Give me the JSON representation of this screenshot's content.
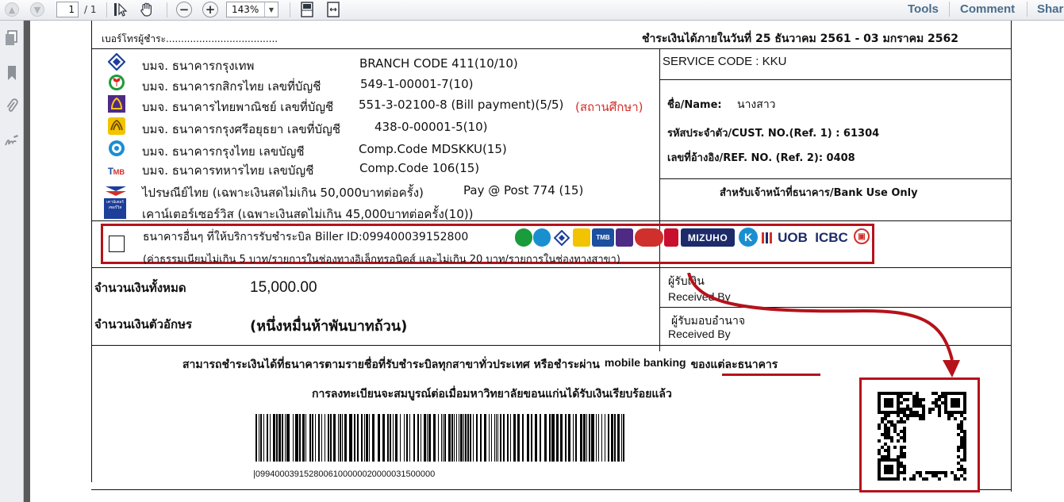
{
  "toolbar": {
    "page_current": "1",
    "page_total": "/ 1",
    "zoom": "143%",
    "tools": "Tools",
    "comment": "Comment",
    "share": "Share"
  },
  "header": {
    "payer_phone": "เบอร์โทรผู้ชำระ.....................................",
    "pay_within": "ชำระเงินได้ภายในวันที่ 25 ธันวาคม   2561 - 03 มกราคม    2562"
  },
  "banks": [
    {
      "name": "บมจ. ธนาคารกรุงเทพ",
      "code": "BRANCH CODE 411(10/10)",
      "icon": "bangkok-bank-icon",
      "color": "#1d3f9a"
    },
    {
      "name": "บมจ. ธนาคารกสิกรไทย  เลขที่บัญชี",
      "code": "549-1-00001-7(10)",
      "icon": "kasikorn-bank-icon",
      "color": "#1a9b3c"
    },
    {
      "name": "บมจ. ธนาคารไทยพาณิชย์ เลขที่บัญชี",
      "code": "551-3-02100-8 (Bill payment)(5/5)",
      "note": "(สถานศึกษา)",
      "icon": "scb-bank-icon",
      "color": "#4e2a84"
    },
    {
      "name": "บมจ. ธนาคารกรุงศรีอยุธยา  เลขที่บัญชี",
      "code": "438-0-00001-5(10)",
      "icon": "krungsri-bank-icon",
      "color": "#f2c300"
    },
    {
      "name": "บมจ. ธนาคารกรุงไทย  เลขบัญชี",
      "code": "Comp.Code MDSKKU(15)",
      "icon": "krungthai-bank-icon",
      "color": "#1a8fd0"
    },
    {
      "name": "บมจ. ธนาคารทหารไทย  เลขบัญชี",
      "code": "Comp.Code 106(15)",
      "icon": "tmb-bank-icon",
      "color": "#1c4fa0"
    }
  ],
  "post": {
    "text": "ไปรษณีย์ไทย (เฉพาะเงินสดไม่เกิน 50,000บาทต่อครั้ง)",
    "code": "Pay @ Post 774 (15)"
  },
  "counter": {
    "text": "เคาน์เตอร์เซอร์วิส (เฉพาะเงินสดไม่เกิน 45,000บาทต่อครั้ง(10))",
    "logo_text": "เคาน์เตอร์เซอร์วิส"
  },
  "right_panel": {
    "service_code": "SERVICE CODE   : KKU",
    "name_label": "ชื่อ/Name:",
    "name_value": "นางสาว",
    "cust_no": "รหัสประจำตัว/CUST. NO.(Ref. 1) : 61304",
    "ref_no": "เลขที่อ้างอิง/REF. NO. (Ref. 2):   0408",
    "bank_use": "สำหรับเจ้าหน้าที่ธนาคาร/Bank Use Only"
  },
  "other_banks": {
    "line1": "ธนาคารอื่นๆ ที่ให้บริการรับชำระบิล Biller ID:099400039152800",
    "line2": "(ค่าธรรมเนียมไม่เกิน 5 บาท/รายการในช่องทางอิเล็กทรอนิคส์ และไม่เกิน 20 บาท/รายการในช่องทางสาขา)",
    "logos": [
      "MIZUHO",
      "UOB",
      "ICBC",
      "TMB"
    ]
  },
  "amount": {
    "total_label": "จำนวนเงินทั้งหมด",
    "total_value": "15,000.00",
    "words_label": "จำนวนเงินตัวอักษร",
    "words_value": "(หนึ่งหมื่นห้าพันบาทถ้วน)"
  },
  "received": {
    "receiver": "ผู้รับเงิน",
    "received_by_1": "Received By",
    "authorized": "ผู้รับมอบอำนาจ",
    "received_by_2": "Received By"
  },
  "footer": {
    "line1_a": "สามารถชำระเงินได้ที่ธนาคารตามรายชื่อที่รับชำระบิลทุกสาขาทั่วประเทศ หรือชำระผ่าน",
    "line1_highlight": "mobile banking",
    "line1_b": "ของแต่ละธนาคาร",
    "line2": "การลงทะเบียนจะสมบูรณ์ต่อเมื่อมหาวิทยาลัยขอนแก่นได้รับเงินเรียบร้อยแล้ว",
    "barcode_number": "|0994000391528006100000020000031500000"
  },
  "colors": {
    "highlight_red": "#b5121b",
    "link_blue": "#4a6d8c"
  }
}
